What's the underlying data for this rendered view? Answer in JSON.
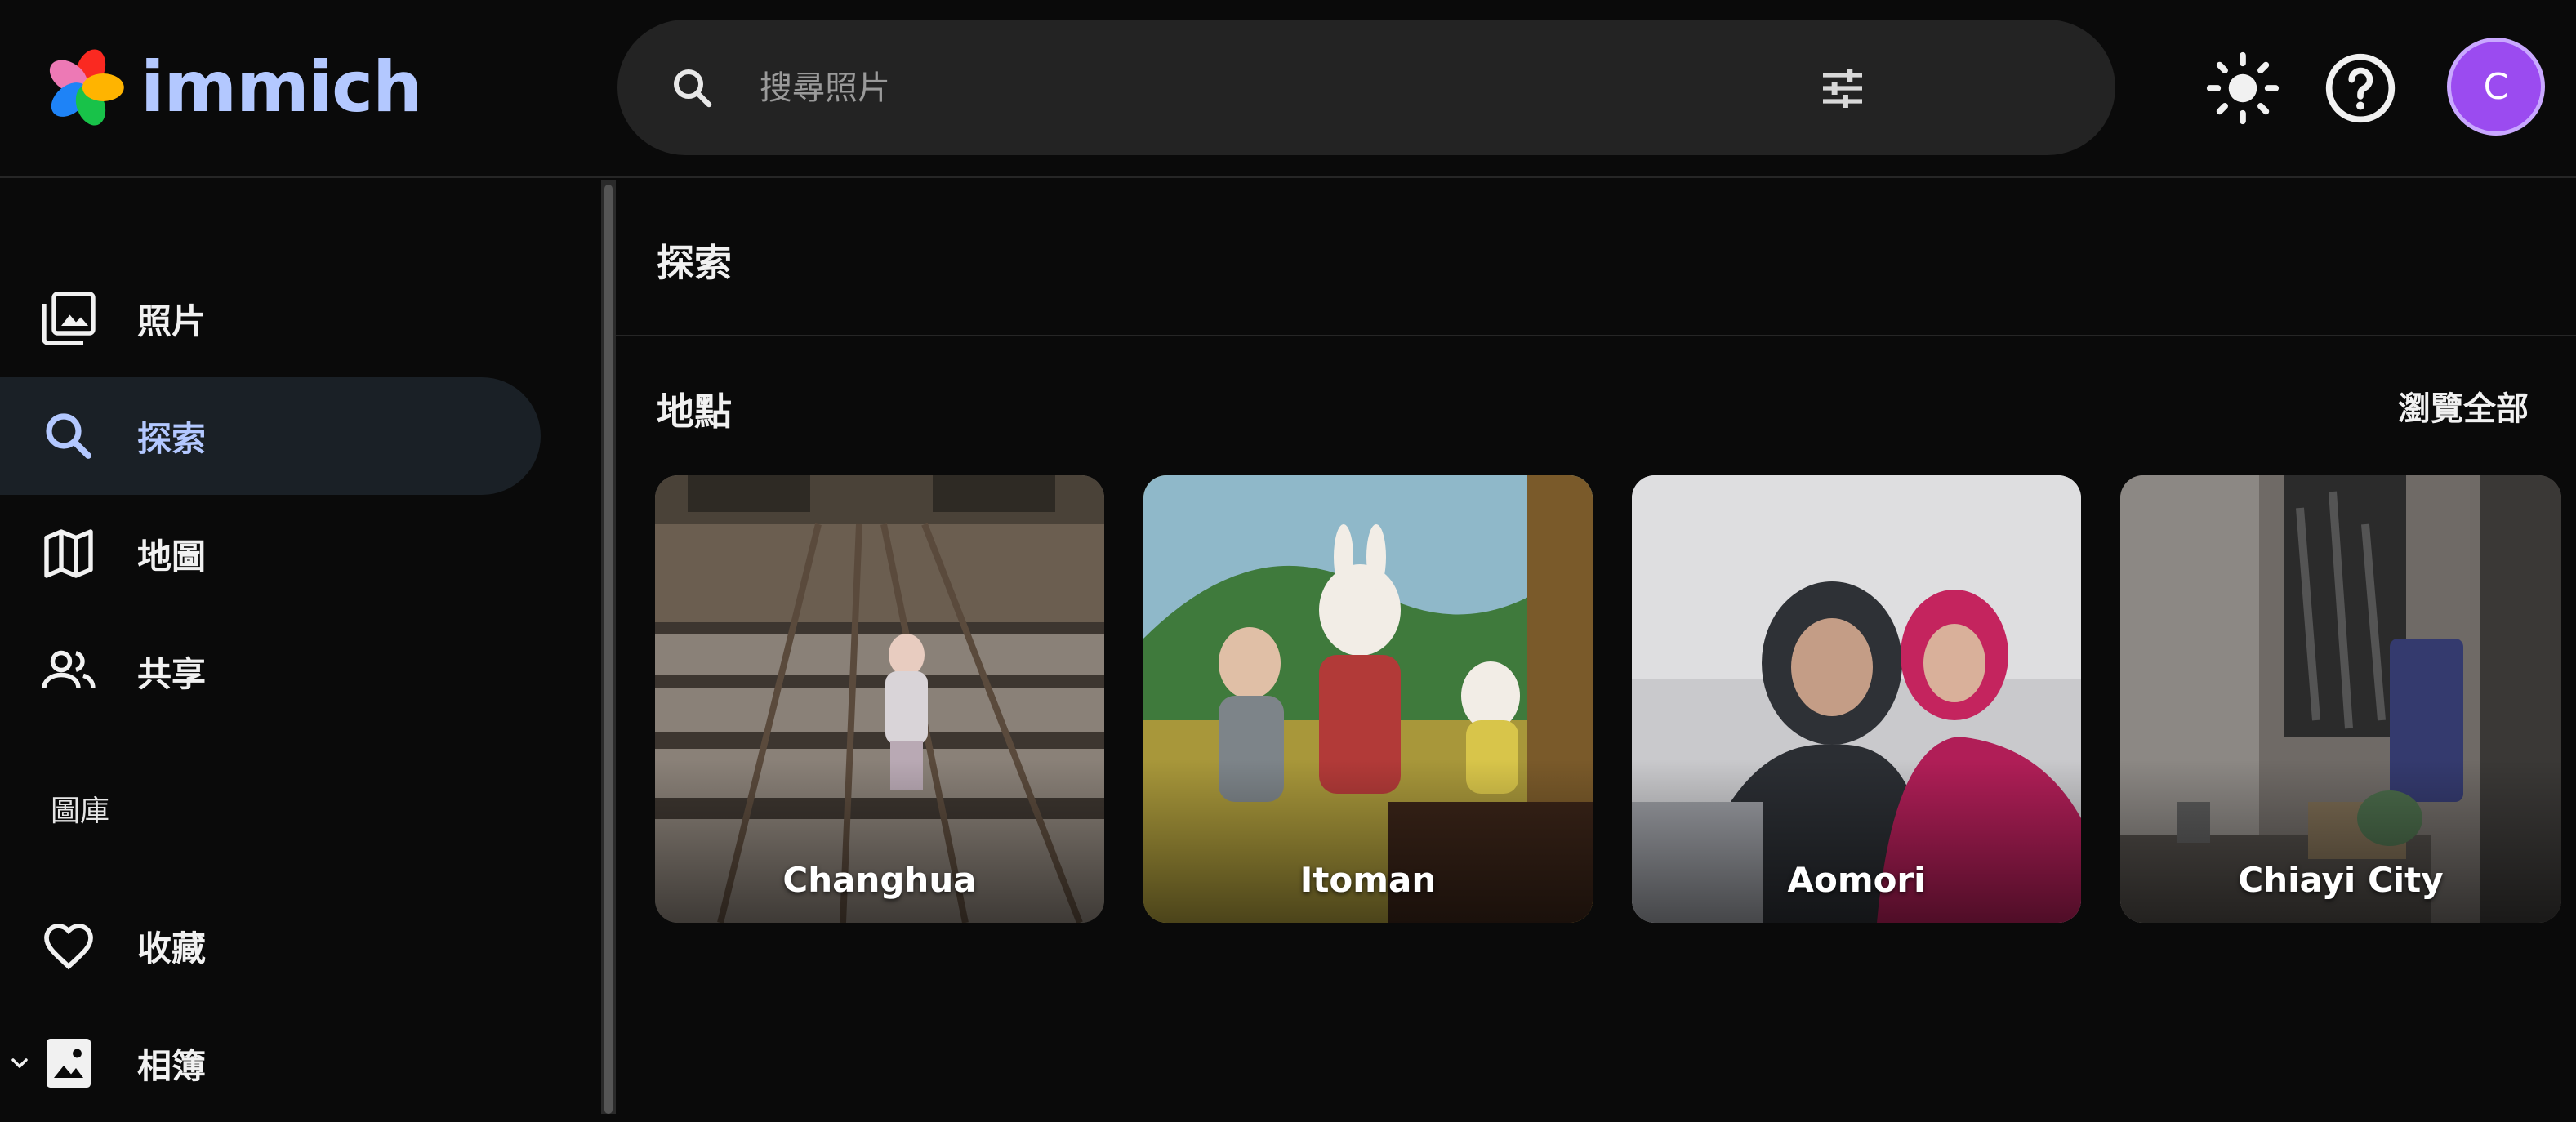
{
  "app": {
    "name": "immich"
  },
  "header": {
    "search": {
      "placeholder": "搜尋照片"
    },
    "avatar_initial": "C"
  },
  "sidebar": {
    "items": [
      {
        "label": "照片",
        "icon": "photos-icon"
      },
      {
        "label": "探索",
        "icon": "search-icon",
        "active": true
      },
      {
        "label": "地圖",
        "icon": "map-icon"
      },
      {
        "label": "共享",
        "icon": "people-icon"
      }
    ],
    "library_label": "圖庫",
    "library_items": [
      {
        "label": "收藏",
        "icon": "heart-icon"
      },
      {
        "label": "相簿",
        "icon": "album-icon"
      }
    ]
  },
  "main": {
    "title": "探索",
    "places": {
      "title": "地點",
      "view_all": "瀏覽全部",
      "items": [
        {
          "name": "Changhua"
        },
        {
          "name": "Itoman"
        },
        {
          "name": "Aomori"
        },
        {
          "name": "Chiayi City"
        }
      ]
    }
  },
  "colors": {
    "background": "#0a0a0a",
    "accent": "#b3c8ff",
    "avatar": "#9b4bf0",
    "active_bg": "#1a2026"
  }
}
